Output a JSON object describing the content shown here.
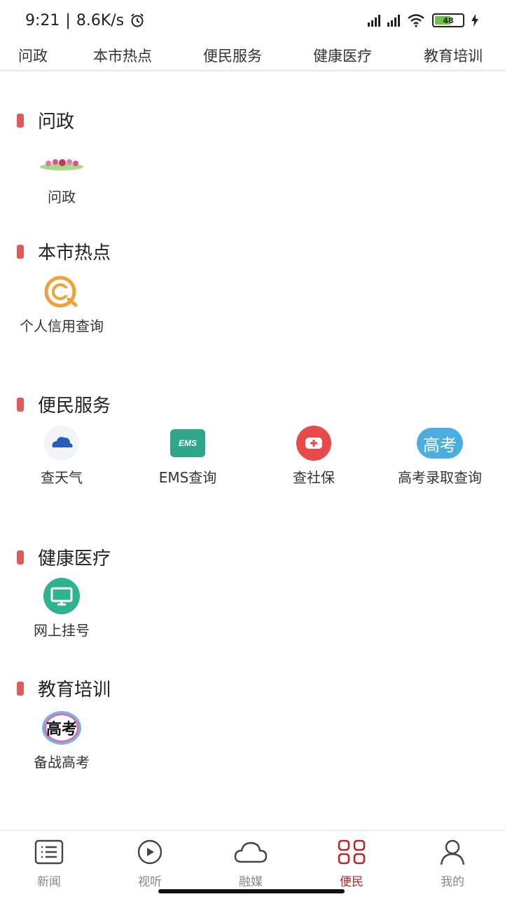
{
  "status": {
    "time": "9:21",
    "network_speed": "8.6K/s",
    "battery": "48"
  },
  "top_tabs": [
    "问政",
    "本市热点",
    "便民服务",
    "健康医疗",
    "教育培训"
  ],
  "sections": [
    {
      "title": "问政",
      "items": [
        {
          "label": "问政",
          "icon": "banner-icon"
        }
      ]
    },
    {
      "title": "本市热点",
      "items": [
        {
          "label": "个人信用查询",
          "icon": "credit-icon"
        }
      ]
    },
    {
      "title": "便民服务",
      "items": [
        {
          "label": "查天气",
          "icon": "cloud-icon"
        },
        {
          "label": "EMS查询",
          "icon": "ems-icon",
          "icon_text": "EMS"
        },
        {
          "label": "查社保",
          "icon": "plus-icon"
        },
        {
          "label": "高考录取查询",
          "icon": "gaokao-icon",
          "icon_text": "高考"
        }
      ]
    },
    {
      "title": "健康医疗",
      "items": [
        {
          "label": "网上挂号",
          "icon": "monitor-icon"
        }
      ]
    },
    {
      "title": "教育培训",
      "items": [
        {
          "label": "备战高考",
          "icon": "gaokao-logo-icon",
          "icon_text": "高考"
        }
      ]
    }
  ],
  "bottom_nav": [
    {
      "label": "新闻",
      "icon": "news-list-icon"
    },
    {
      "label": "视听",
      "icon": "play-icon"
    },
    {
      "label": "融媒",
      "icon": "cloud-outline-icon"
    },
    {
      "label": "便民",
      "icon": "grid-icon",
      "active": true
    },
    {
      "label": "我的",
      "icon": "user-icon"
    }
  ],
  "colors": {
    "accent": "#b8262c",
    "section_marker": "#e05a5a",
    "ems": "#2fa58a",
    "social_security": "#e84a4a",
    "gaokao": "#4aaee0",
    "registration": "#2fb38f"
  }
}
